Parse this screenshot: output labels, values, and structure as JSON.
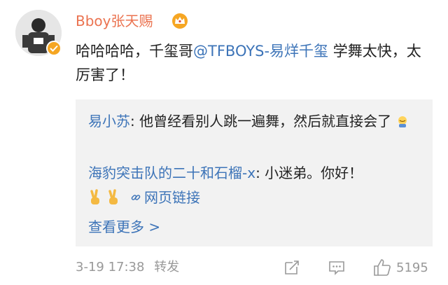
{
  "post": {
    "username": "Bboy张天赐",
    "body_prefix": "哈哈哈哈，千玺哥",
    "mention": "@TFBOYS-易烊千玺",
    "body_suffix": " 学舞太快，太厉害了！",
    "comments": [
      {
        "author": "易小苏",
        "separator": ": ",
        "text": "他曾经看别人跳一遍舞，然后就直接会了"
      },
      {
        "author": "海豹突击队的二十和石榴-x",
        "separator": ": ",
        "text": "小迷弟。你好！"
      }
    ],
    "link_label": "网页链接",
    "view_more": "查看更多 >",
    "timestamp": "3-19 17:38",
    "source": "转发",
    "like_count": "5195"
  },
  "colors": {
    "username": "#eb7350",
    "link": "#3d74b8",
    "muted": "#999999",
    "panel": "#f2f2f2"
  },
  "icons": [
    "verified-badge-icon",
    "crown-icon",
    "victory-hand-icon",
    "link-icon",
    "repost-icon",
    "comment-icon",
    "like-icon",
    "emoji-icon"
  ]
}
